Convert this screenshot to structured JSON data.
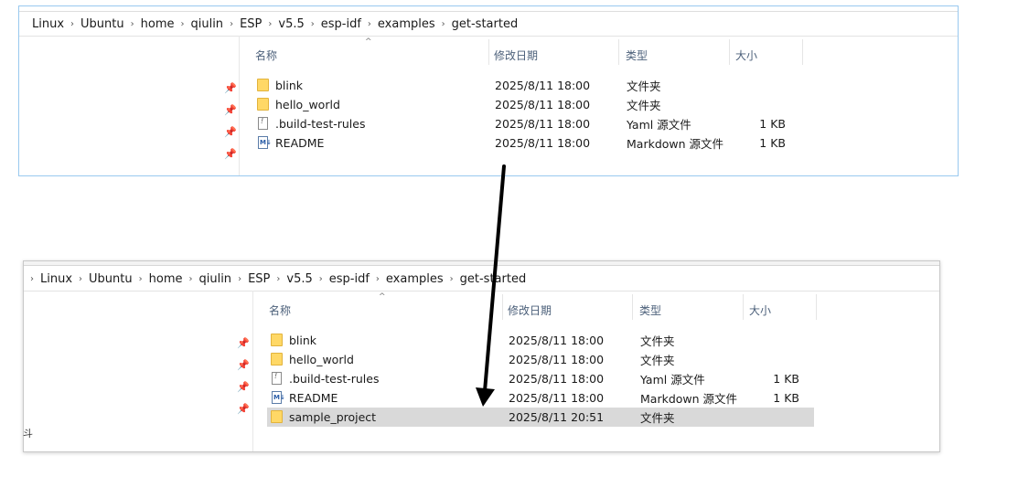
{
  "breadcrumb": [
    "Linux",
    "Ubuntu",
    "home",
    "qiulin",
    "ESP",
    "v5.5",
    "esp-idf",
    "examples",
    "get-started"
  ],
  "columns": {
    "name": "名称",
    "date": "修改日期",
    "type": "类型",
    "size": "大小"
  },
  "sort_indicator": "^",
  "top_files": [
    {
      "name": "blink",
      "date": "2025/8/11 18:00",
      "type": "文件夹",
      "size": "",
      "icon": "folder-icon"
    },
    {
      "name": "hello_world",
      "date": "2025/8/11 18:00",
      "type": "文件夹",
      "size": "",
      "icon": "folder-icon"
    },
    {
      "name": ".build-test-rules",
      "date": "2025/8/11 18:00",
      "type": "Yaml 源文件",
      "size": "1 KB",
      "icon": "yaml-file-icon"
    },
    {
      "name": "README",
      "date": "2025/8/11 18:00",
      "type": "Markdown 源文件",
      "size": "1 KB",
      "icon": "markdown-file-icon"
    }
  ],
  "bottom_files": [
    {
      "name": "blink",
      "date": "2025/8/11 18:00",
      "type": "文件夹",
      "size": "",
      "icon": "folder-icon"
    },
    {
      "name": "hello_world",
      "date": "2025/8/11 18:00",
      "type": "文件夹",
      "size": "",
      "icon": "folder-icon"
    },
    {
      "name": ".build-test-rules",
      "date": "2025/8/11 18:00",
      "type": "Yaml 源文件",
      "size": "1 KB",
      "icon": "yaml-file-icon"
    },
    {
      "name": "README",
      "date": "2025/8/11 18:00",
      "type": "Markdown 源文件",
      "size": "1 KB",
      "icon": "markdown-file-icon"
    },
    {
      "name": "sample_project",
      "date": "2025/8/11 20:51",
      "type": "文件夹",
      "size": "",
      "icon": "folder-icon",
      "selected": true
    }
  ],
  "stray_glyph": "斗",
  "colors": {
    "selection": "#d9d9d9",
    "header_text": "#4c607a",
    "folder": "#ffd866",
    "top_border": "#99c9ef"
  }
}
